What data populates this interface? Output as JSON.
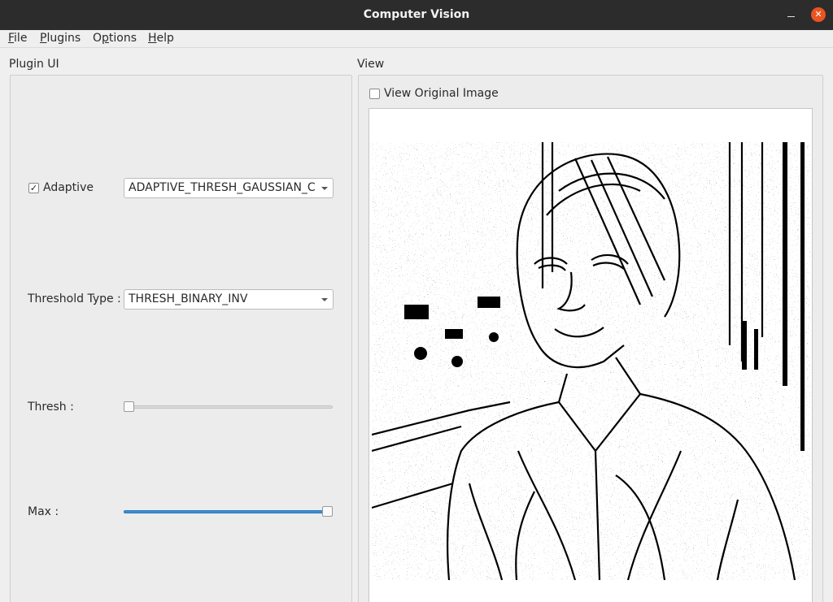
{
  "window": {
    "title": "Computer Vision"
  },
  "menu": [
    {
      "label": "File",
      "mnemonic": "F",
      "rest": "ile"
    },
    {
      "label": "Plugins",
      "mnemonic": "P",
      "rest": "lugins"
    },
    {
      "label": "Options",
      "mnemonic": "O",
      "rest": "ptions",
      "mnemonic_index": 1
    },
    {
      "label": "Help",
      "mnemonic": "H",
      "rest": "elp"
    }
  ],
  "plugin_ui": {
    "title": "Plugin UI",
    "adaptive": {
      "label": "Adaptive",
      "checked": true,
      "method": "ADAPTIVE_THRESH_GAUSSIAN_C"
    },
    "threshold_type": {
      "label": "Threshold Type :",
      "value": "THRESH_BINARY_INV"
    },
    "thresh": {
      "label": "Thresh :",
      "fraction": 0.0
    },
    "max": {
      "label": "Max :",
      "fraction": 1.0
    }
  },
  "view": {
    "title": "View",
    "view_original": {
      "label": "View Original Image",
      "checked": false
    }
  },
  "colors": {
    "accent": "#3a8fd9",
    "close": "#e95420",
    "titlebar": "#2c2c2c"
  }
}
